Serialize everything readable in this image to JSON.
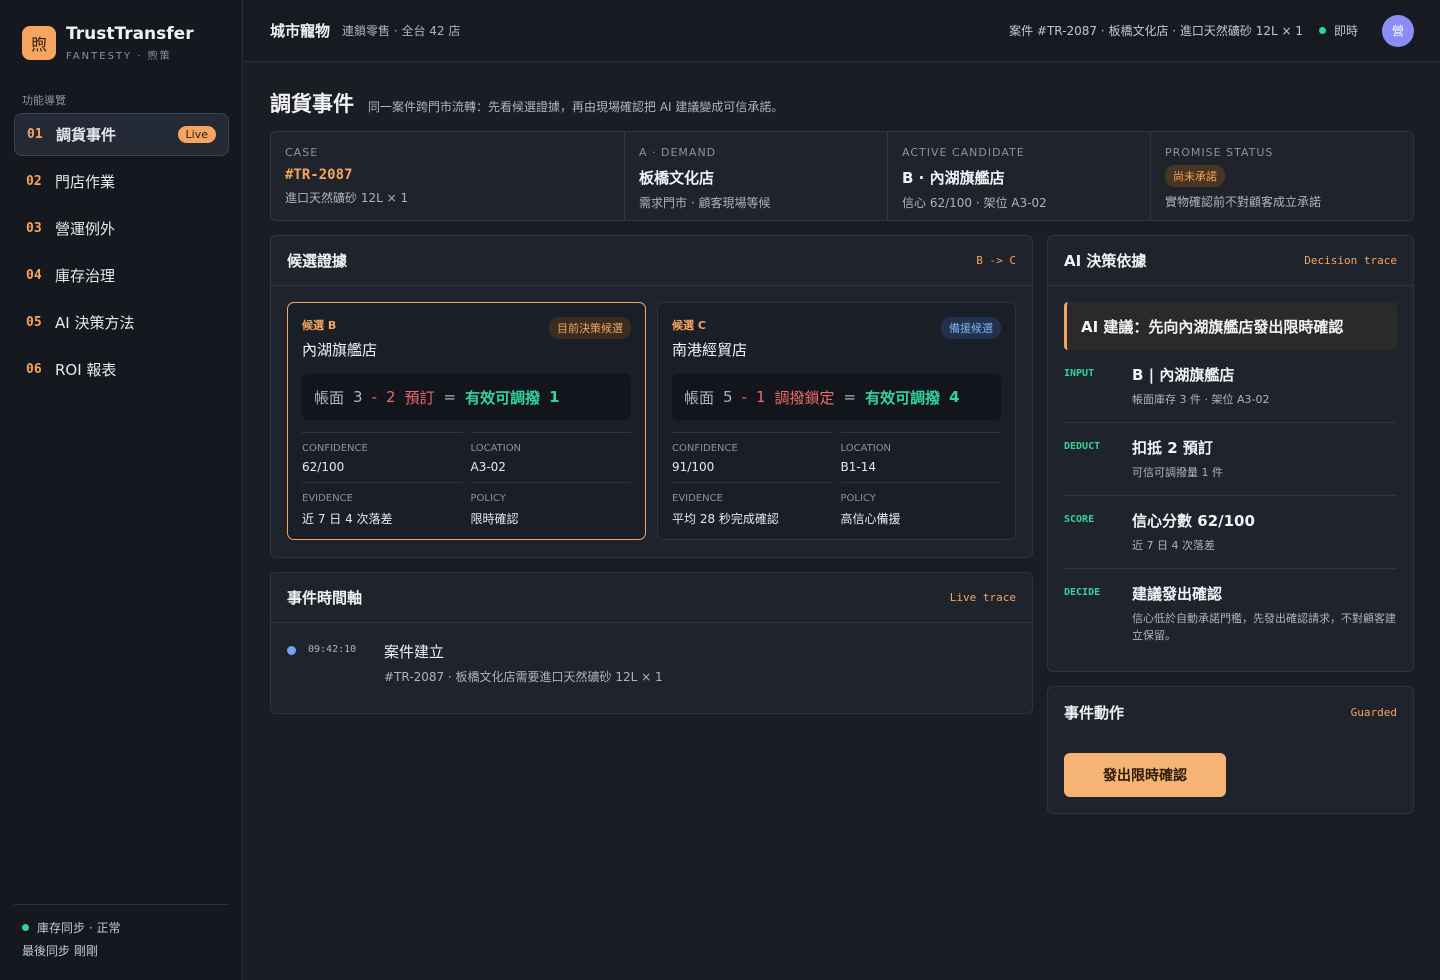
{
  "brand": {
    "logo": "煦",
    "name": "TrustTransfer",
    "sub": "FANTESTY · 煦策"
  },
  "nav": {
    "title": "功能導覽",
    "items": [
      {
        "num": "01",
        "label": "調貨事件",
        "badge": "Live"
      },
      {
        "num": "02",
        "label": "門店作業"
      },
      {
        "num": "03",
        "label": "營運例外"
      },
      {
        "num": "04",
        "label": "庫存治理"
      },
      {
        "num": "05",
        "label": "AI 決策方法"
      },
      {
        "num": "06",
        "label": "ROI 報表"
      }
    ]
  },
  "footer": {
    "sync_status": "庫存同步 · 正常",
    "last_sync": "最後同步 剛剛"
  },
  "topbar": {
    "org_name": "城市寵物",
    "org_sub": "連鎖零售 · 全台 42 店",
    "case_info": "案件 #TR-2087 · 板橋文化店 · 進口天然礦砂 12L × 1",
    "live": "即時",
    "avatar": "營"
  },
  "page": {
    "title": "調貨事件",
    "desc": "同一案件跨門市流轉：先看候選證據，再由現場確認把 AI 建議變成可信承諾。"
  },
  "summary": {
    "case": {
      "label": "CASE",
      "value": "#TR-2087",
      "sub": "進口天然礦砂 12L × 1"
    },
    "demand": {
      "label": "A · DEMAND",
      "value": "板橋文化店",
      "sub": "需求門市 · 顧客現場等候"
    },
    "candidate": {
      "label": "ACTIVE CANDIDATE",
      "value": "B · 內湖旗艦店",
      "sub": "信心 62/100 · 架位 A3-02"
    },
    "promise": {
      "label": "PROMISE STATUS",
      "pill": "尚未承諾",
      "sub": "實物確認前不對顧客成立承諾"
    }
  },
  "candidates_panel": {
    "title": "候選證據",
    "tag": "B -> C",
    "cards": [
      {
        "tag": "候選 B",
        "name": "內湖旗艦店",
        "badge": "目前決策候選",
        "formula": {
          "label": "帳面",
          "book": "3",
          "minus": "-",
          "deduct": "2",
          "deduct_label": "預訂",
          "eq": "=",
          "result_label": "有效可調撥",
          "result": "1"
        },
        "confidence_label": "CONFIDENCE",
        "confidence": "62/100",
        "location_label": "LOCATION",
        "location": "A3-02",
        "evidence_label": "EVIDENCE",
        "evidence": "近 7 日 4 次落差",
        "policy_label": "POLICY",
        "policy": "限時確認"
      },
      {
        "tag": "候選 C",
        "name": "南港經貿店",
        "badge": "備援候選",
        "formula": {
          "label": "帳面",
          "book": "5",
          "minus": "-",
          "deduct": "1",
          "deduct_label": "調撥鎖定",
          "eq": "=",
          "result_label": "有效可調撥",
          "result": "4"
        },
        "confidence_label": "CONFIDENCE",
        "confidence": "91/100",
        "location_label": "LOCATION",
        "location": "B1-14",
        "evidence_label": "EVIDENCE",
        "evidence": "平均 28 秒完成確認",
        "policy_label": "POLICY",
        "policy": "高信心備援"
      }
    ]
  },
  "timeline": {
    "title": "事件時間軸",
    "tag": "Live trace",
    "events": [
      {
        "time": "09:42:10",
        "title": "案件建立",
        "sub": "#TR-2087 · 板橋文化店需要進口天然礦砂 12L × 1"
      }
    ]
  },
  "ai": {
    "title": "AI 決策依據",
    "tag": "Decision trace",
    "recommendation": "AI 建議：先向內湖旗艦店發出限時確認",
    "trace": [
      {
        "key": "INPUT",
        "title": "B | 內湖旗艦店",
        "sub": "帳面庫存 3 件 · 架位 A3-02"
      },
      {
        "key": "DEDUCT",
        "title": "扣抵 2 預訂",
        "sub": "可信可調撥量 1 件"
      },
      {
        "key": "SCORE",
        "title": "信心分數 62/100",
        "sub": "近 7 日 4 次落差"
      },
      {
        "key": "DECIDE",
        "title": "建議發出確認",
        "sub": "信心低於自動承諾門檻，先發出確認請求，不對顧客建立保留。"
      }
    ]
  },
  "actions": {
    "title": "事件動作",
    "tag": "Guarded",
    "button": "發出限時確認"
  },
  "colors": {
    "accent": "#f5a55f",
    "success": "#34d399",
    "danger": "#ef6b6b",
    "info": "#6ea3f5"
  }
}
